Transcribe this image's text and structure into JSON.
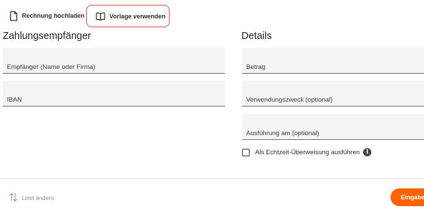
{
  "actions": {
    "upload_label": "Rechnung hochladen",
    "template_label": "Vorlage verwenden"
  },
  "recipient_section": {
    "title": "Zahlungsempfänger",
    "name_placeholder": "Empfänger (Name oder Firma)",
    "iban_placeholder": "IBAN"
  },
  "details_section": {
    "title": "Details",
    "amount_placeholder": "Betrag",
    "purpose_placeholder": "Verwendungszweck (optional)",
    "date_placeholder": "Ausführung am (optional)",
    "instant_label": "Als Echtzeit-Überweisung ausführen",
    "instant_checked": false
  },
  "footer": {
    "limit_label": "Limit ändern",
    "submit_label": "Eingaben"
  },
  "colors": {
    "accent": "#ff6200",
    "highlight_border": "#e0474c",
    "field_background": "#f4f4f4"
  }
}
